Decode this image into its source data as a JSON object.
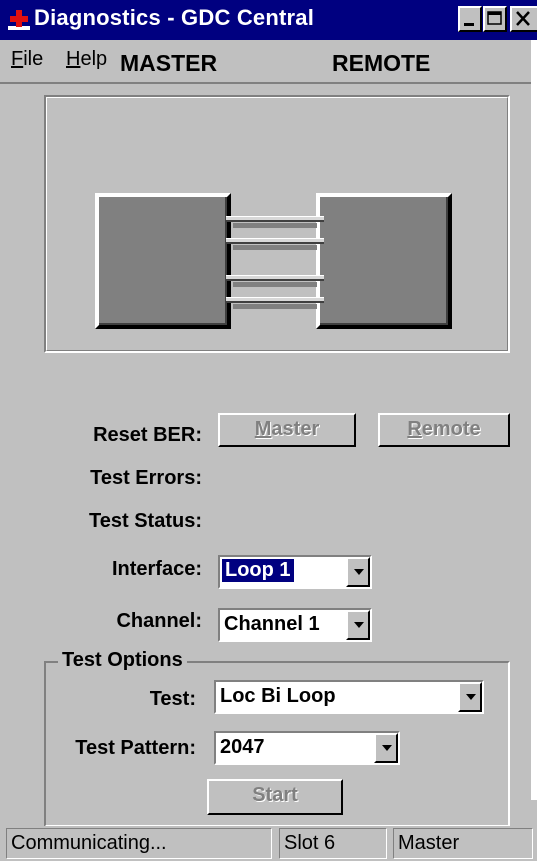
{
  "window": {
    "title": "Diagnostics - GDC Central",
    "icon": "red-cross-icon"
  },
  "menu": {
    "items": [
      {
        "label": "File",
        "mnemonic": "F",
        "rest": "ile"
      },
      {
        "label": "Help",
        "mnemonic": "H",
        "rest": "elp"
      }
    ]
  },
  "diagram": {
    "master_label": "MASTER",
    "remote_label": "REMOTE"
  },
  "reset_ber": {
    "label": "Reset BER:",
    "master_button": {
      "mnemonic": "M",
      "rest": "aster",
      "enabled": false
    },
    "remote_button": {
      "mnemonic": "R",
      "rest": "emote",
      "enabled": false
    }
  },
  "test_errors": {
    "label": "Test Errors:",
    "value": ""
  },
  "test_status": {
    "label": "Test Status:",
    "value": ""
  },
  "interface": {
    "label": "Interface:",
    "selected": "Loop 1"
  },
  "channel": {
    "label": "Channel:",
    "selected": "Channel 1"
  },
  "test_options": {
    "title": "Test Options",
    "test": {
      "label": "Test:",
      "selected": "Loc Bi Loop"
    },
    "test_pattern": {
      "label": "Test Pattern:",
      "selected": "2047"
    },
    "start_button": {
      "label": "Start",
      "enabled": false
    }
  },
  "status_bar": {
    "message": "Communicating...",
    "slot": "Slot 6",
    "role": "Master"
  },
  "colors": {
    "titlebar": "#000080",
    "face": "#c0c0c0",
    "device": "#808080",
    "icon_red": "#e01010"
  }
}
